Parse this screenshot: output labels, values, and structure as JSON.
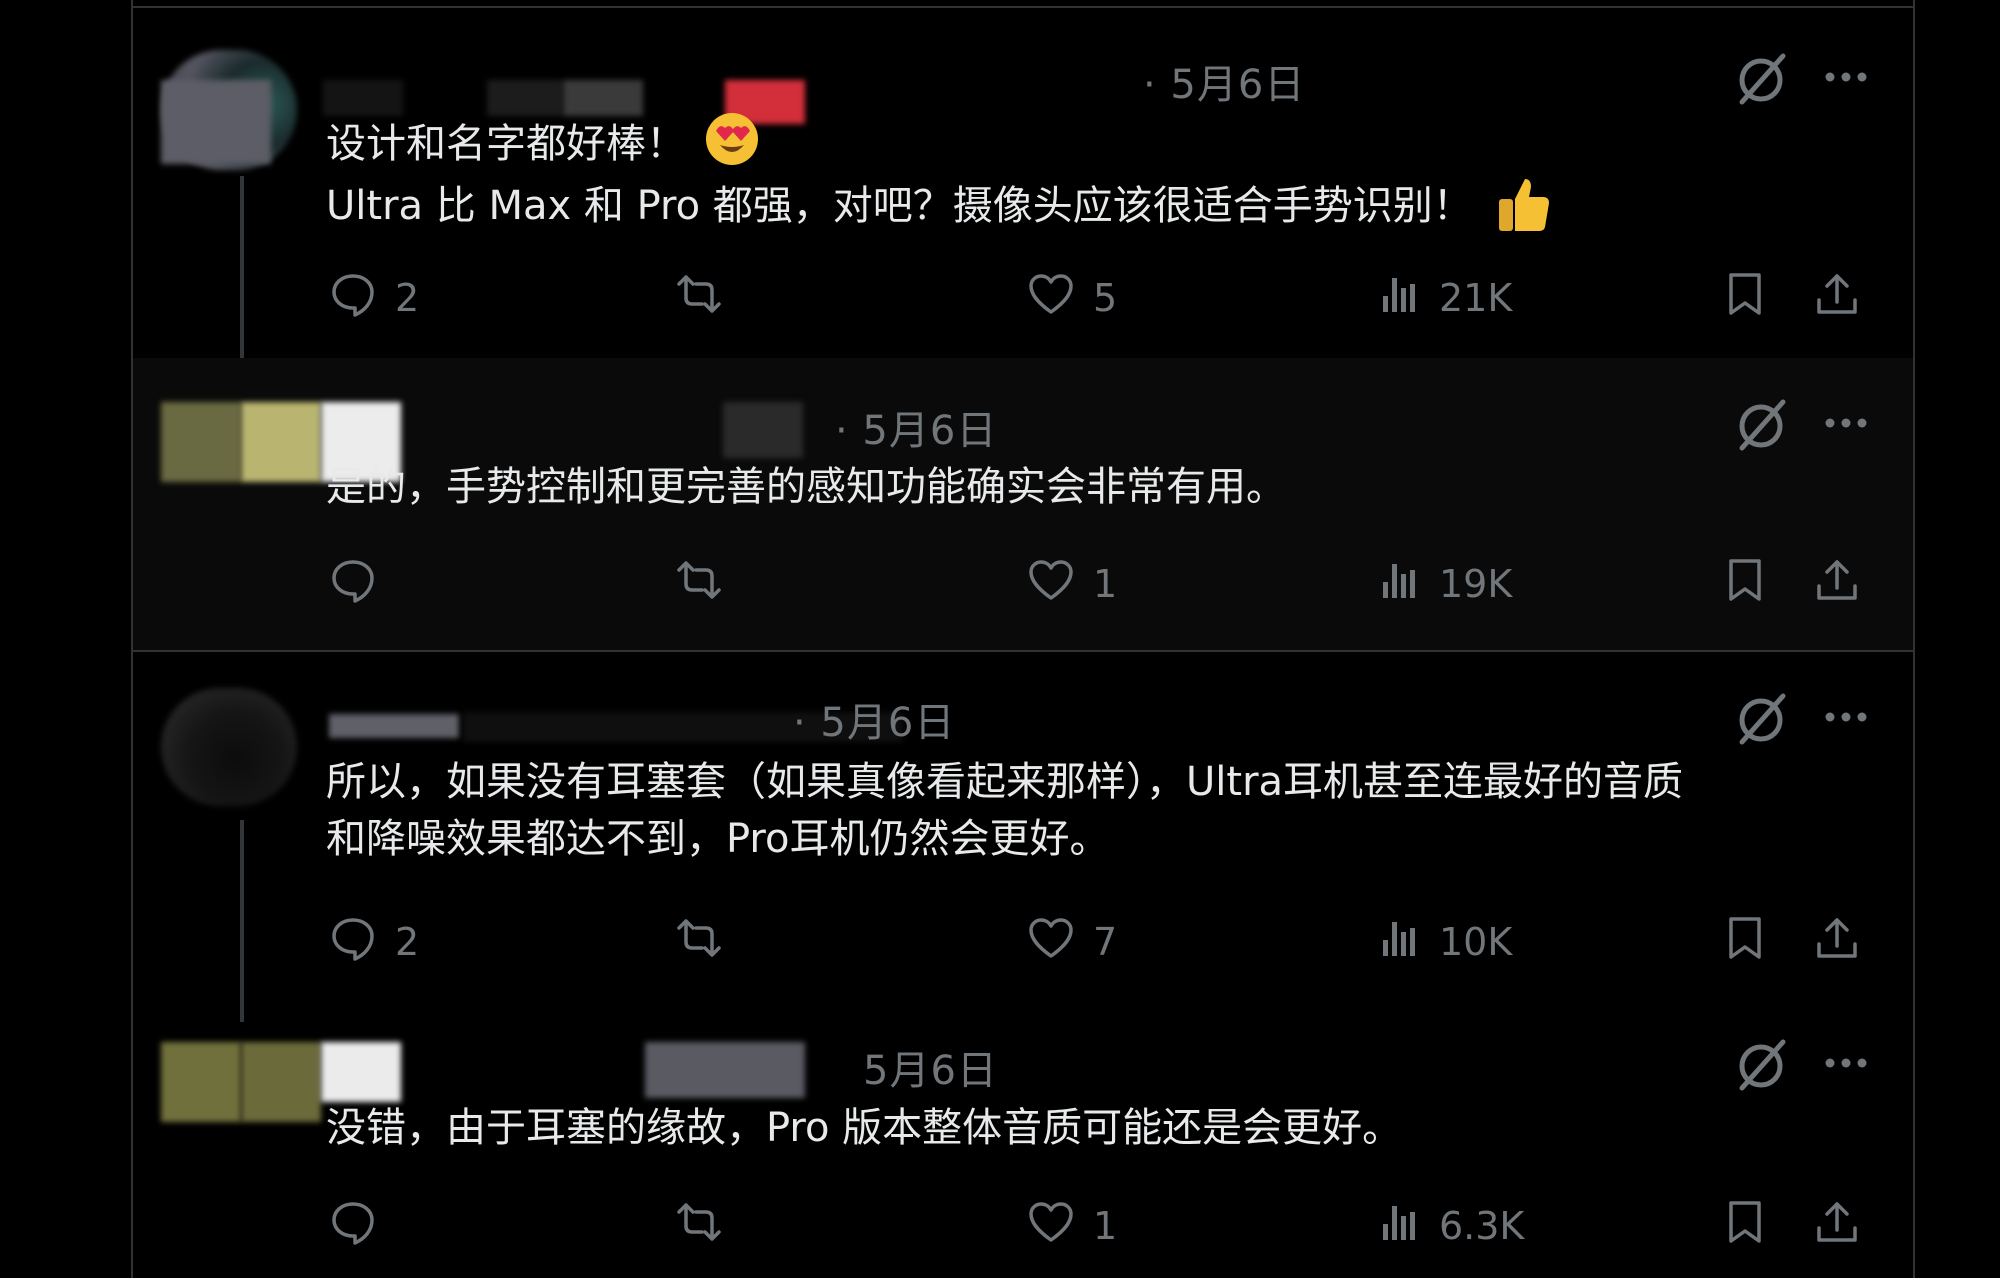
{
  "tweets": [
    {
      "date": "· 5月6日",
      "lines": [
        "设计和名字都好棒！",
        "Ultra 比 Max 和 Pro 都强，对吧？摄像头应该很适合手势识别！"
      ],
      "reply_count": "2",
      "like_count": "5",
      "view_count": "21K"
    },
    {
      "date": "· 5月6日",
      "lines": [
        "是的，手势控制和更完善的感知功能确实会非常有用。"
      ],
      "reply_count": "",
      "like_count": "1",
      "view_count": "19K"
    },
    {
      "date": "· 5月6日",
      "lines": [
        "所以，如果没有耳塞套（如果真像看起来那样），Ultra耳机甚至连最好的音质",
        "和降噪效果都达不到，Pro耳机仍然会更好。"
      ],
      "reply_count": "2",
      "like_count": "7",
      "view_count": "10K"
    },
    {
      "date": "5月6日",
      "lines": [
        "没错，由于耳塞的缘故，Pro 版本整体音质可能还是会更好。"
      ],
      "reply_count": "",
      "like_count": "1",
      "view_count": "6.3K"
    }
  ],
  "icons": {
    "reply": "reply-icon",
    "repost": "repost-icon",
    "like": "like-icon",
    "views": "views-icon",
    "bookmark": "bookmark-icon",
    "share": "share-icon",
    "grok": "grok-icon",
    "more": "more-icon"
  },
  "colors": {
    "background": "#000000",
    "text": "#e7e9ea",
    "muted": "#71767b",
    "divider": "#2f3336"
  }
}
